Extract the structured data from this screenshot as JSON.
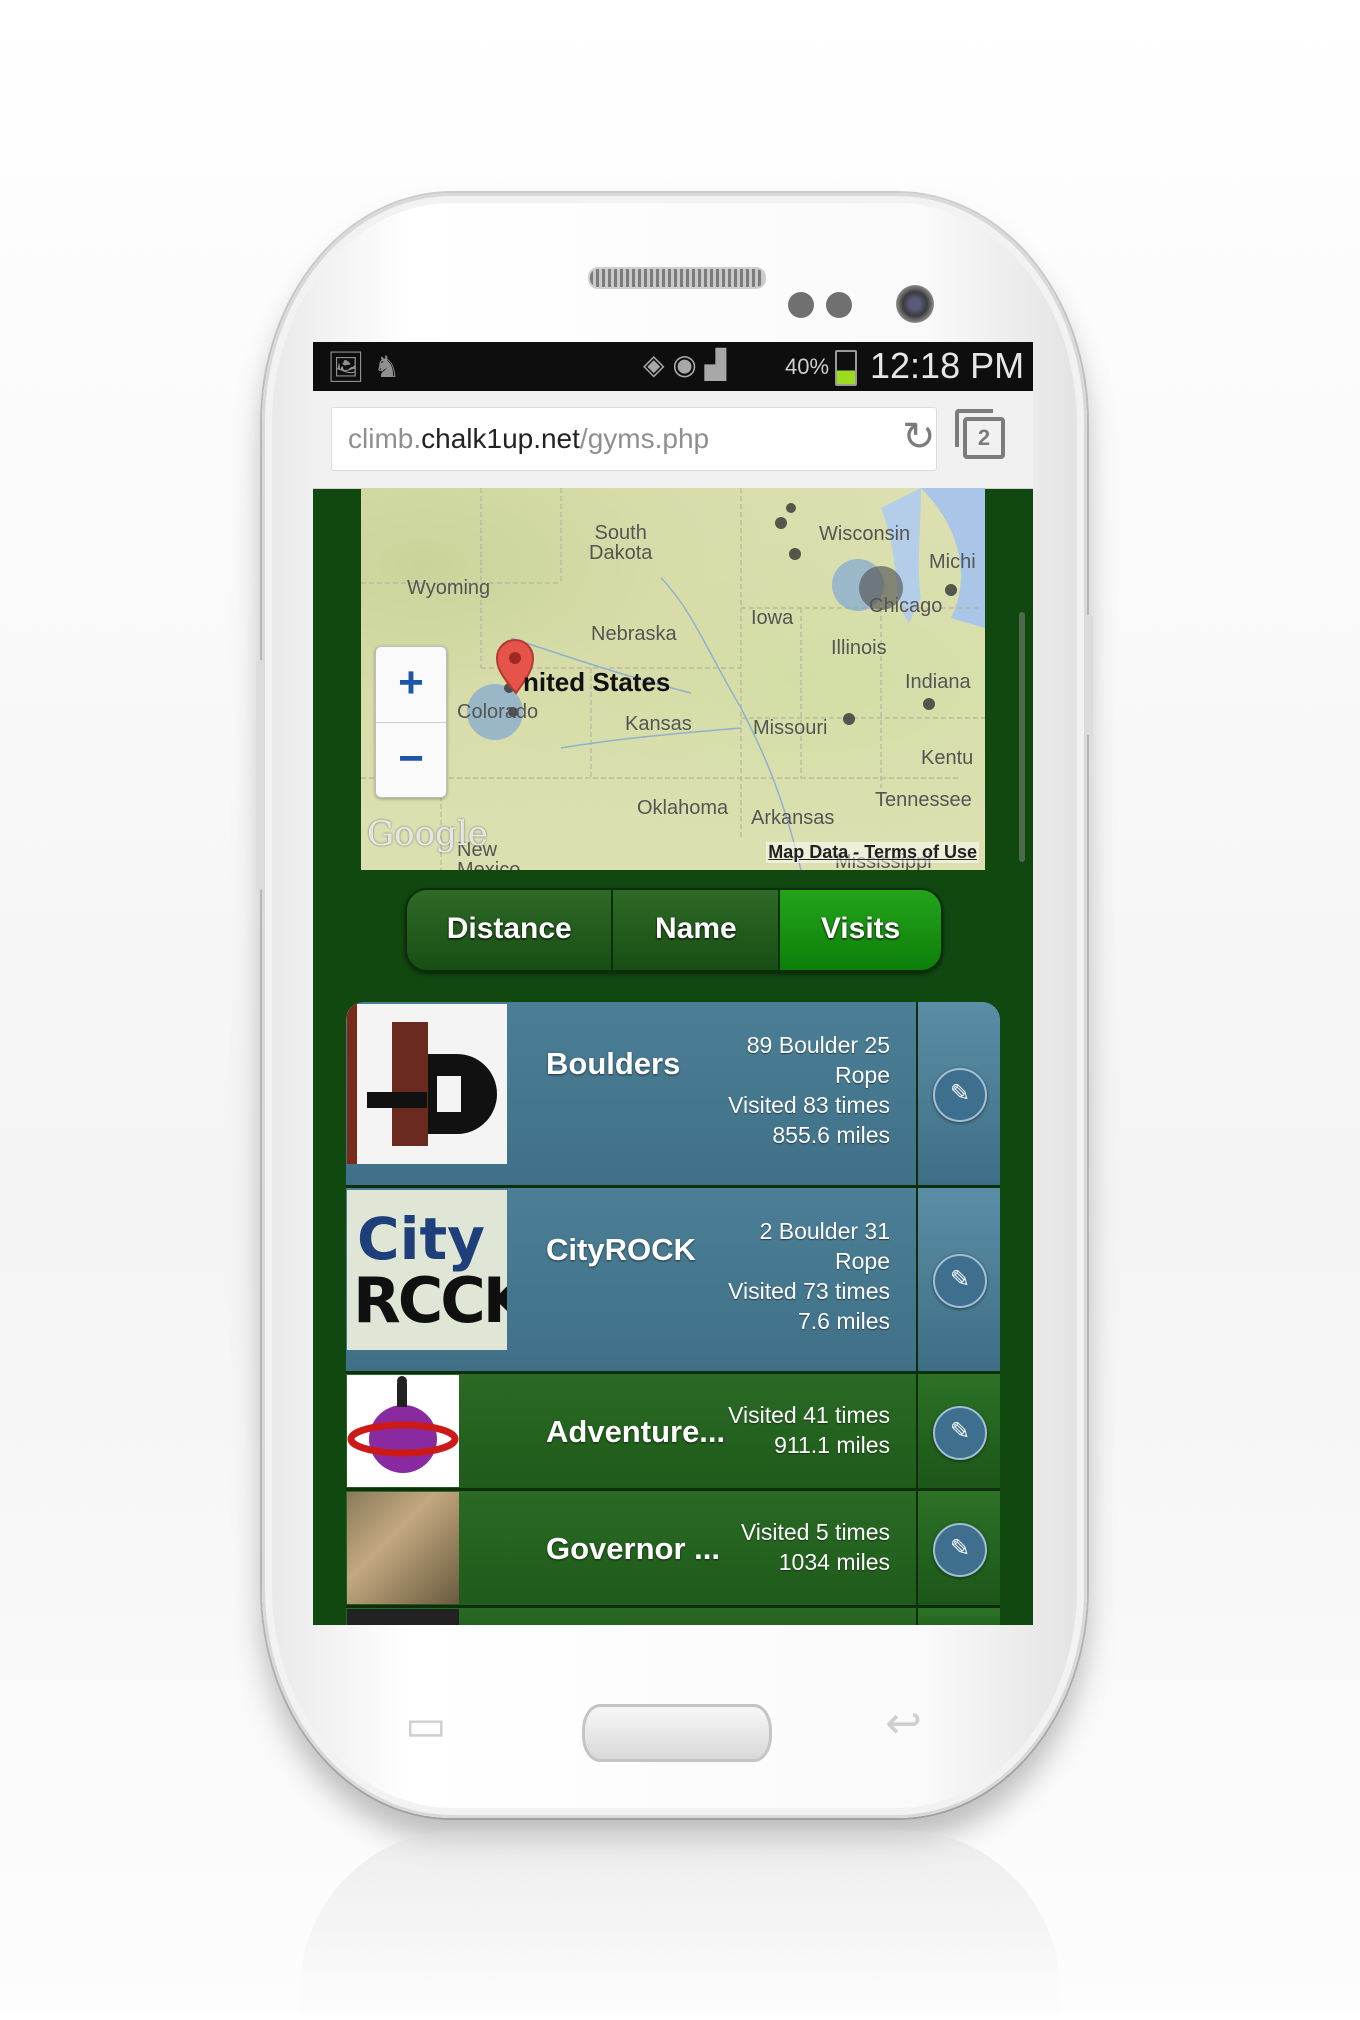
{
  "status_bar": {
    "battery_percent": "40%",
    "time": "12:18 PM"
  },
  "browser": {
    "url_prefix": "climb.",
    "url_host": "chalk1up.net",
    "url_path": "/gyms.php",
    "tab_count": "2"
  },
  "map": {
    "labels": {
      "south_dakota": "South\nDakota",
      "wisconsin": "Wisconsin",
      "michigan": "Michi",
      "wyoming": "Wyoming",
      "iowa": "Iowa",
      "chicago": "Chicago",
      "nebraska": "Nebraska",
      "illinois": "Illinois",
      "united_states": "nited States",
      "indiana": "Indiana",
      "colorado": "Colorado",
      "kansas": "Kansas",
      "missouri": "Missouri",
      "kentucky": "Kentu",
      "tennessee": "Tennessee",
      "oklahoma": "Oklahoma",
      "arkansas": "Arkansas",
      "new_mexico": "New\nMexico",
      "mississippi": "Mississippi"
    },
    "zoom_in": "+",
    "zoom_out": "−",
    "logo": "Google",
    "attribution": "Map Data - Terms of Use"
  },
  "sort_tabs": {
    "distance": "Distance",
    "name": "Name",
    "visits": "Visits",
    "active": "Visits"
  },
  "gyms": [
    {
      "name": "Boulders",
      "boulder_rope": "89 Boulder 25",
      "rope_line": "Rope",
      "visits": "Visited 83 times",
      "distance": "855.6 miles"
    },
    {
      "name": "CityROCK",
      "boulder_rope": "2 Boulder 31",
      "rope_line": "Rope",
      "visits": "Visited 73 times",
      "distance": "7.6 miles",
      "logo_top": "City",
      "logo_bottom": "RCCK"
    },
    {
      "name": "Adventure...",
      "visits": "Visited 41 times",
      "distance": "911.1 miles"
    },
    {
      "name": "Governor ...",
      "visits": "Visited 5 times",
      "distance": "1034 miles"
    }
  ],
  "colors": {
    "page_bg": "#114810",
    "active_tab": "#1c9a15",
    "row_blue": "#44768d",
    "row_green": "#256322"
  },
  "icons": [
    "gallery-icon",
    "wifi-icon",
    "signal-icon",
    "battery-icon",
    "reload-icon",
    "tabs-icon",
    "edit-icon",
    "menu-icon",
    "back-icon"
  ]
}
